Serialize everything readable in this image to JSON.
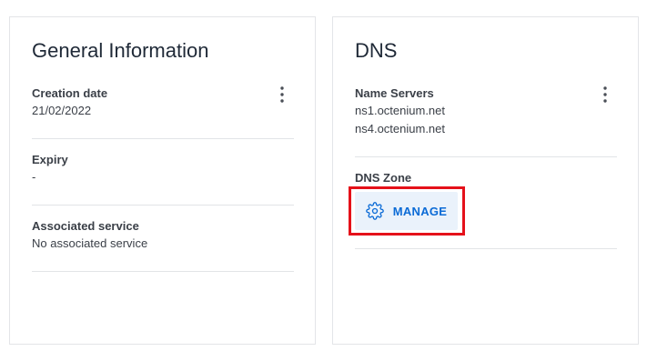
{
  "general": {
    "title": "General Information",
    "creation_date_label": "Creation date",
    "creation_date_value": "21/02/2022",
    "expiry_label": "Expiry",
    "expiry_value": "-",
    "associated_service_label": "Associated service",
    "associated_service_value": "No associated service"
  },
  "dns": {
    "title": "DNS",
    "name_servers_label": "Name Servers",
    "name_servers": [
      "ns1.octenium.net",
      "ns4.octenium.net"
    ],
    "dns_zone_label": "DNS Zone",
    "manage_label": "MANAGE"
  },
  "icons": {
    "menu": "vertical-ellipsis-icon",
    "manage": "gear-icon"
  },
  "colors": {
    "accent": "#0b6bd6",
    "button_bg": "#eaf2fb",
    "highlight": "#e5111a"
  }
}
